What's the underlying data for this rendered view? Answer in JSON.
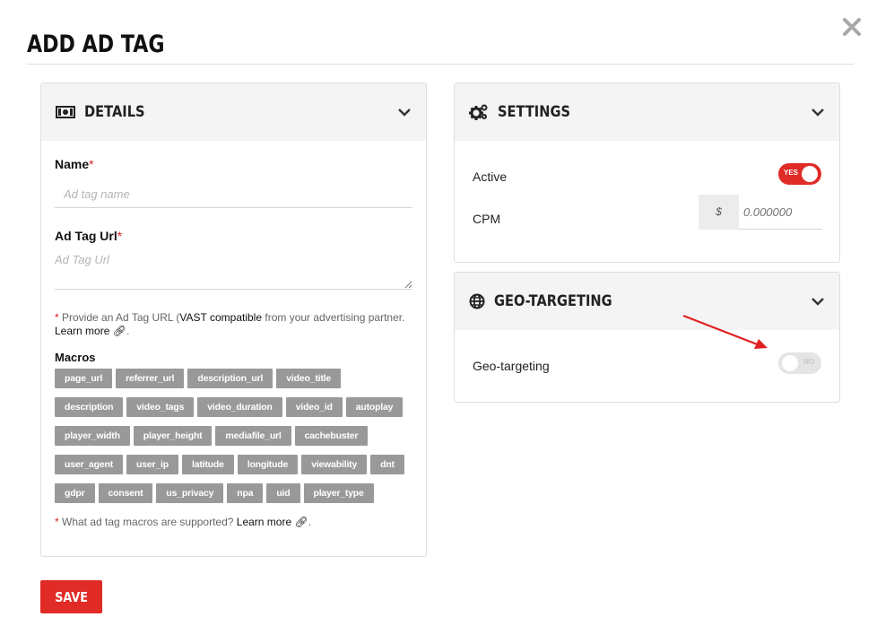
{
  "modal": {
    "title": "ADD AD TAG",
    "close_icon": "close-icon"
  },
  "details": {
    "title": "DETAILS",
    "icon": "money-icon",
    "name_label": "Name",
    "name_required": "*",
    "name_placeholder": "Ad tag name",
    "url_label": "Ad Tag Url",
    "url_required": "*",
    "url_placeholder": "Ad Tag Url",
    "url_note": {
      "star": "*",
      "pre": " Provide an Ad Tag URL (",
      "vast": "VAST compatible",
      "post": " from your advertising partner.",
      "learn_more": "Learn more",
      "end": "."
    },
    "macros_title": "Macros",
    "macros": [
      "page_url",
      "referrer_url",
      "description_url",
      "video_title",
      "description",
      "video_tags",
      "video_duration",
      "video_id",
      "autoplay",
      "player_width",
      "player_height",
      "mediafile_url",
      "cachebuster",
      "user_agent",
      "user_ip",
      "latitude",
      "longitude",
      "viewability",
      "dnt",
      "gdpr",
      "consent",
      "us_privacy",
      "npa",
      "uid",
      "player_type"
    ],
    "macros_note": {
      "star": "*",
      "text": " What ad tag macros are supported? ",
      "learn_more": "Learn more",
      "end": "."
    }
  },
  "settings": {
    "title": "SETTINGS",
    "icon": "gears-icon",
    "active_label": "Active",
    "active_toggle": "YES",
    "cpm_label": "CPM",
    "cpm_currency": "$",
    "cpm_placeholder": "0.000000"
  },
  "geo": {
    "title": "GEO-TARGETING",
    "icon": "globe-icon",
    "label": "Geo-targeting",
    "toggle": "NO"
  },
  "save_label": "SAVE",
  "colors": {
    "accent": "#e02b27",
    "chip": "#999999",
    "header_bg": "#f4f4f4"
  }
}
